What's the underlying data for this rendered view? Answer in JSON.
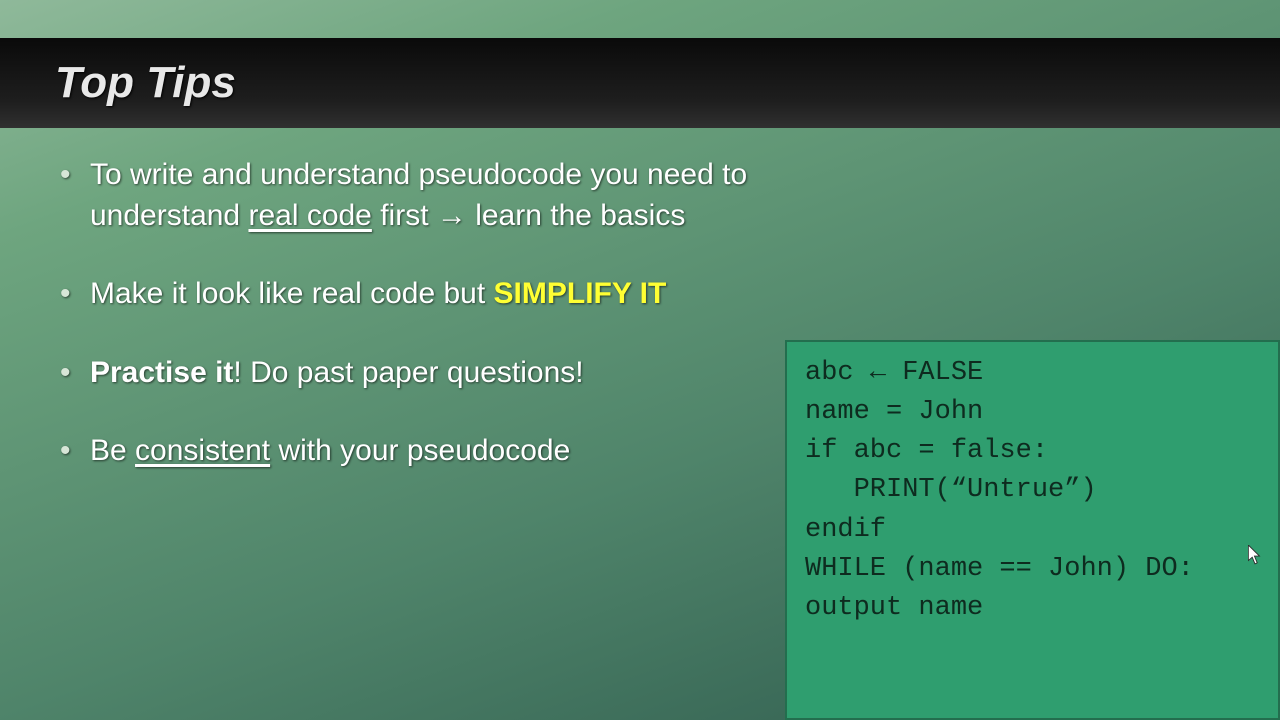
{
  "title": "Top Tips",
  "bullets": {
    "b1_pre": "To write and understand pseudocode you need to understand ",
    "b1_real_code": "real code",
    "b1_first": " first ",
    "b1_arrow": "→",
    "b1_learn": " learn the basics",
    "b2_pre": "Make it look like real code but ",
    "b2_simplify": "SIMPLIFY IT",
    "b3_practise": "Practise it",
    "b3_rest": "! Do past paper questions!",
    "b4_pre": "Be ",
    "b4_consistent": "consistent",
    "b4_post": " with your pseudocode"
  },
  "code": {
    "l1_a": "abc ",
    "l1_arrow": "←",
    "l1_b": " FALSE",
    "l2": "name = John",
    "l3": "",
    "l4": "if abc = false:",
    "l5": "   PRINT(“Untrue”)",
    "l6": "endif",
    "l7": "",
    "l8": "WHILE (name == John) DO:",
    "l9": "output name"
  }
}
